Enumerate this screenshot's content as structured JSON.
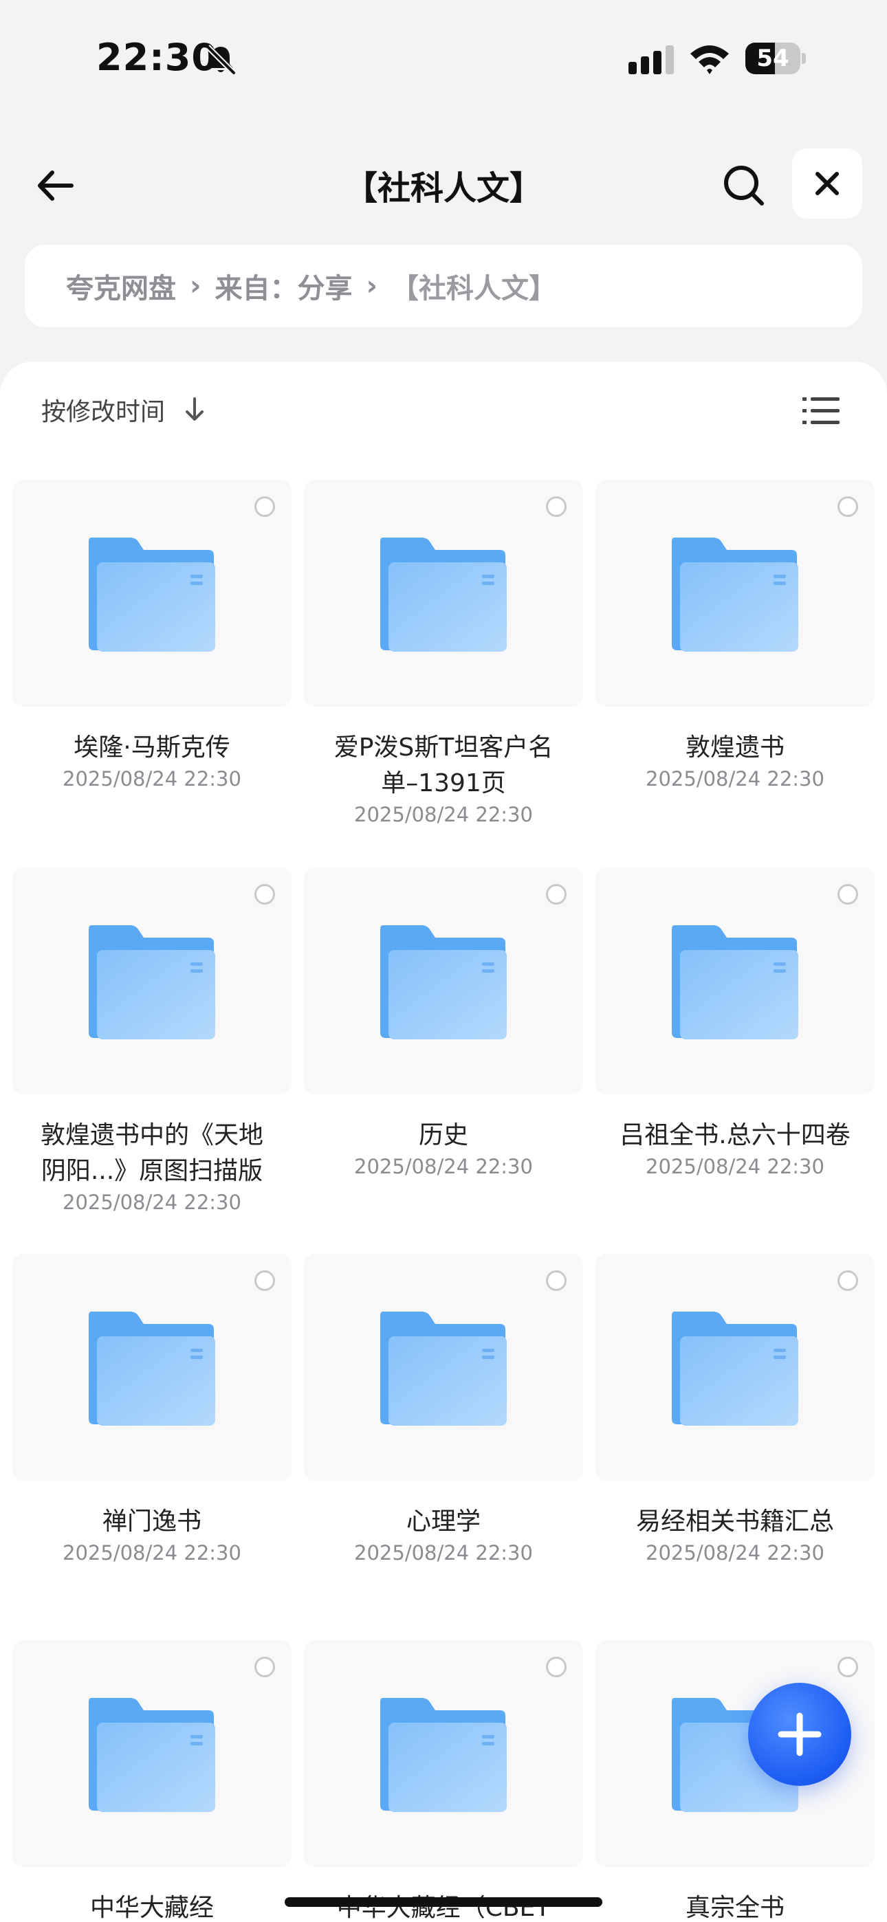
{
  "status_bar": {
    "time": "22:30",
    "battery_level": "54",
    "battery_fraction": 0.54
  },
  "nav": {
    "title": "【社科人文】"
  },
  "breadcrumb": {
    "items": [
      "夸克网盘",
      "来自：分享",
      "【社科人文】"
    ],
    "separator": "›"
  },
  "sort": {
    "label": "按修改时间"
  },
  "colors": {
    "accent": "#1c5cf2",
    "folder": "#5aa9f5",
    "folder_light": "#a8d2fb"
  },
  "folders": [
    {
      "name": "埃隆·马斯克传",
      "date": "2025/08/24 22:30"
    },
    {
      "name": "爱P泼S斯T坦客户名单–1391页",
      "date": "2025/08/24 22:30"
    },
    {
      "name": "敦煌遗书",
      "date": "2025/08/24 22:30"
    },
    {
      "name": "敦煌遗书中的《天地阴阳...》原图扫描版",
      "date": "2025/08/24 22:30"
    },
    {
      "name": "历史",
      "date": "2025/08/24 22:30"
    },
    {
      "name": "吕祖全书.总六十四卷",
      "date": "2025/08/24 22:30"
    },
    {
      "name": "禅门逸书",
      "date": "2025/08/24 22:30"
    },
    {
      "name": "心理学",
      "date": "2025/08/24 22:30"
    },
    {
      "name": "易经相关书籍汇总",
      "date": "2025/08/24 22:30"
    },
    {
      "name": "中华大藏经",
      "date": ""
    },
    {
      "name": "中华大藏经（CBET",
      "date": ""
    },
    {
      "name": "真宗全书",
      "date": ""
    }
  ],
  "icons": [
    "back-arrow-icon",
    "search-icon",
    "close-icon",
    "sort-arrow-icon",
    "list-view-icon",
    "folder-icon",
    "plus-icon"
  ]
}
